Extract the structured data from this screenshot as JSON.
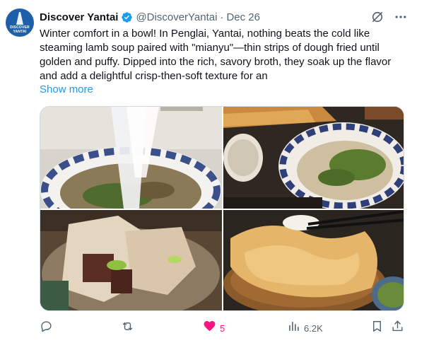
{
  "post": {
    "author": {
      "display_name": "Discover Yantai",
      "handle": "@DiscoverYantai",
      "verified": true,
      "avatar_text": "DISCOVER YANTAI"
    },
    "separator": "·",
    "date": "Dec 26",
    "text": "Winter comfort in a bowl! In Penglai, Yantai, nothing beats the cold like steaming lamb soup paired with \"mianyu\"—thin strips of dough fried until golden and puffy. Dipped into the rich, savory broth, they soak up the flavor and add a delightful crisp-then-soft texture for an",
    "show_more_label": "Show more",
    "media": [
      {
        "icon": "photo-noodles-pulled-over-bowl"
      },
      {
        "icon": "photo-lamb-soup-and-fried-dough"
      },
      {
        "icon": "photo-lamb-soup-closeup"
      },
      {
        "icon": "photo-fried-dough-mianyu-basket"
      }
    ],
    "actions": {
      "reply": {
        "icon": "reply-icon",
        "count": ""
      },
      "repost": {
        "icon": "repost-icon",
        "count": ""
      },
      "like": {
        "icon": "heart-filled-icon",
        "count": "5",
        "liked": true,
        "color": "#f91880"
      },
      "views": {
        "icon": "views-bar-chart-icon",
        "count": "6.2K"
      },
      "bookmark": {
        "icon": "bookmark-icon"
      },
      "share": {
        "icon": "share-icon"
      }
    }
  },
  "colors": {
    "text": "#0f1419",
    "secondary": "#536471",
    "link": "#1d9bf0",
    "verified": "#1d9bf0",
    "like": "#f91880"
  }
}
